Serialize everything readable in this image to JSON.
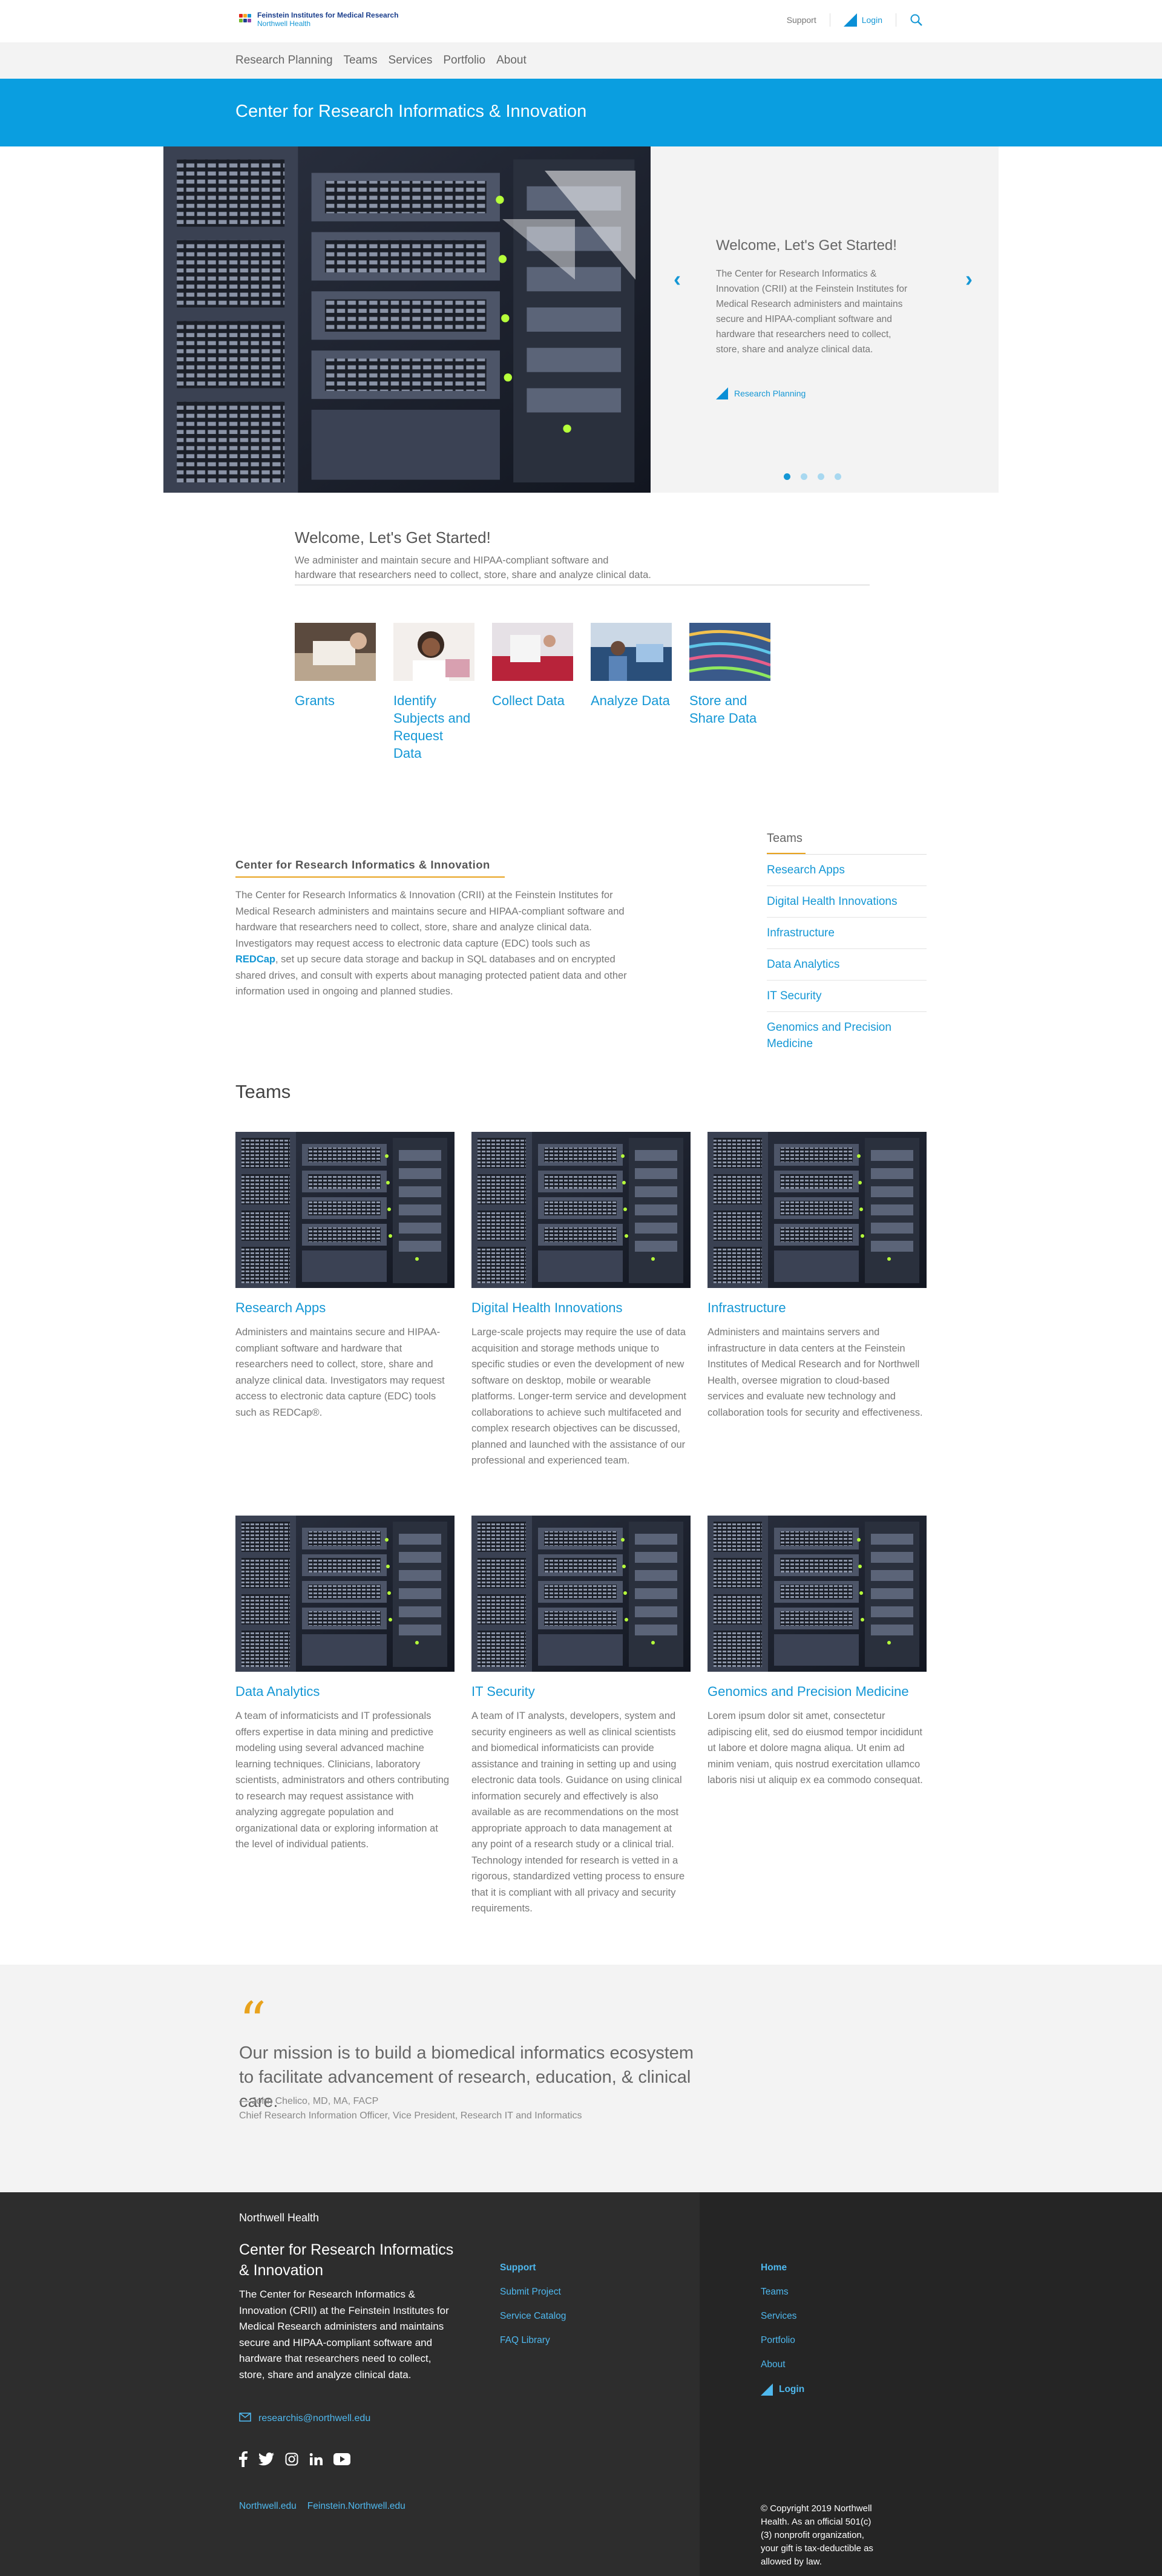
{
  "header": {
    "logo_line1": "Feinstein Institutes for Medical Research",
    "logo_line2": "Northwell Health",
    "support": "Support",
    "login": "Login"
  },
  "nav": {
    "items": [
      "Research Planning",
      "Teams",
      "Services",
      "Portfolio",
      "About"
    ]
  },
  "banner": {
    "title": "Center for Research Informatics & Innovation"
  },
  "hero": {
    "heading": "Welcome, Let's Get Started!",
    "text": "The Center for Research Informatics & Innovation (CRII) at the Feinstein Institutes for Medical Research administers and maintains secure and HIPAA-compliant software and hardware that researchers need to collect, store, share and analyze clinical data.",
    "link": "Research Planning",
    "prev": "‹",
    "next": "›"
  },
  "welcome": {
    "heading": "Welcome, Let's Get Started!",
    "text": "We administer and maintain secure and HIPAA-compliant software and hardware that researchers need to collect, store, share and analyze clinical data.",
    "tiles": [
      {
        "label": "Grants"
      },
      {
        "label": "Identify Subjects and Request Data"
      },
      {
        "label": "Collect Data"
      },
      {
        "label": "Analyze Data"
      },
      {
        "label": "Store and Share Data"
      }
    ]
  },
  "about": {
    "heading": "Center for Research Informatics & Innovation",
    "text_before": "The Center for Research Informatics & Innovation (CRII) at the Feinstein Institutes for Medical Research administers and maintains secure and HIPAA-compliant software and hardware that researchers need to collect, store, share and analyze clinical data. Investigators may request access to electronic data capture (EDC) tools such as ",
    "redcap": "REDCap",
    "text_after": ", set up secure data storage and backup in SQL databases and on encrypted shared drives, and consult with experts about managing protected patient data and other information used in ongoing and planned studies."
  },
  "sidebar": {
    "heading": "Teams",
    "items": [
      "Research Apps",
      "Digital Health Innovations",
      "Infrastructure",
      "Data Analytics",
      "IT Security",
      "Genomics and Precision Medicine"
    ]
  },
  "teams": {
    "title": "Teams",
    "cards": [
      {
        "name": "Research Apps",
        "desc": "Administers and maintains secure and HIPAA-compliant software and hardware that researchers need to collect, store, share and analyze clinical data. Investigators may request access to electronic data capture (EDC) tools such as REDCap®."
      },
      {
        "name": "Digital Health Innovations",
        "desc": "Large-scale projects may require the use of data acquisition and storage methods unique to specific studies or even the development of new software on desktop, mobile or wearable platforms. Longer-term service and development collaborations to achieve such multifaceted and complex research objectives can be discussed, planned and launched with the assistance of our professional and experienced team."
      },
      {
        "name": "Infrastructure",
        "desc": "Administers and maintains servers and infrastructure in data centers at the Feinstein Institutes of Medical Research and for Northwell Health, oversee migration to cloud-based services and evaluate new technology and collaboration tools for security and effectiveness."
      },
      {
        "name": "Data Analytics",
        "desc": "A team of informaticists and IT professionals offers expertise in data mining and predictive modeling using several advanced machine learning techniques. Clinicians, laboratory scientists, administrators and others contributing to research may request assistance with analyzing aggregate population and organizational data or exploring information at the level of individual patients."
      },
      {
        "name": "IT Security",
        "desc": "A team of IT analysts, developers, system and security engineers as well as clinical scientists and biomedical informaticists can provide assistance and training in setting up and using electronic data tools. Guidance on using clinical information securely and effectively is also available as are recommendations on the most appropriate approach to data management at any point of a research study or a clinical trial. Technology intended for research is vetted in a rigorous, standardized vetting process to ensure that it is compliant with all privacy and security requirements."
      },
      {
        "name": "Genomics and Precision Medicine",
        "desc": "Lorem ipsum dolor sit amet, consectetur adipiscing elit, sed do eiusmod tempor incididunt ut labore et dolore magna aliqua. Ut enim ad minim veniam, quis nostrud exercitation ullamco laboris nisi ut aliquip ex ea commodo consequat."
      }
    ]
  },
  "quote": {
    "mark": "“",
    "text": "Our mission is to build a biomedical informatics ecosystem to facilitate advancement of research, education, & clinical care.",
    "author": "— John Chelico, MD, MA, FACP",
    "role": "Chief Research Information Officer, Vice President, Research IT and Informatics"
  },
  "footer": {
    "brand": "Northwell Health",
    "title": "Center for Research Informatics & Innovation",
    "desc": "The Center for Research Informatics & Innovation (CRII) at the Feinstein Institutes for Medical Research administers and maintains secure and HIPAA-compliant software and hardware that researchers need to collect, store, share and analyze clinical data.",
    "email": "researchis@northwell.edu",
    "bottom_links": [
      "Northwell.edu",
      "Feinstein.Northwell.edu"
    ],
    "col1": [
      "Support",
      "Submit Project",
      "Service Catalog",
      "FAQ Library"
    ],
    "col2": [
      "Home",
      "Teams",
      "Services",
      "Portfolio",
      "About"
    ],
    "login": "Login",
    "copyright": "© Copyright 2019 Northwell Health. As an official 501(c)(3) nonprofit organization, your gift is tax-deductible as allowed by law."
  },
  "colors": {
    "accent": "#1497d5",
    "banner": "#0a9ee0",
    "orange": "#e8a21c",
    "footer": "#2d2d2d"
  }
}
